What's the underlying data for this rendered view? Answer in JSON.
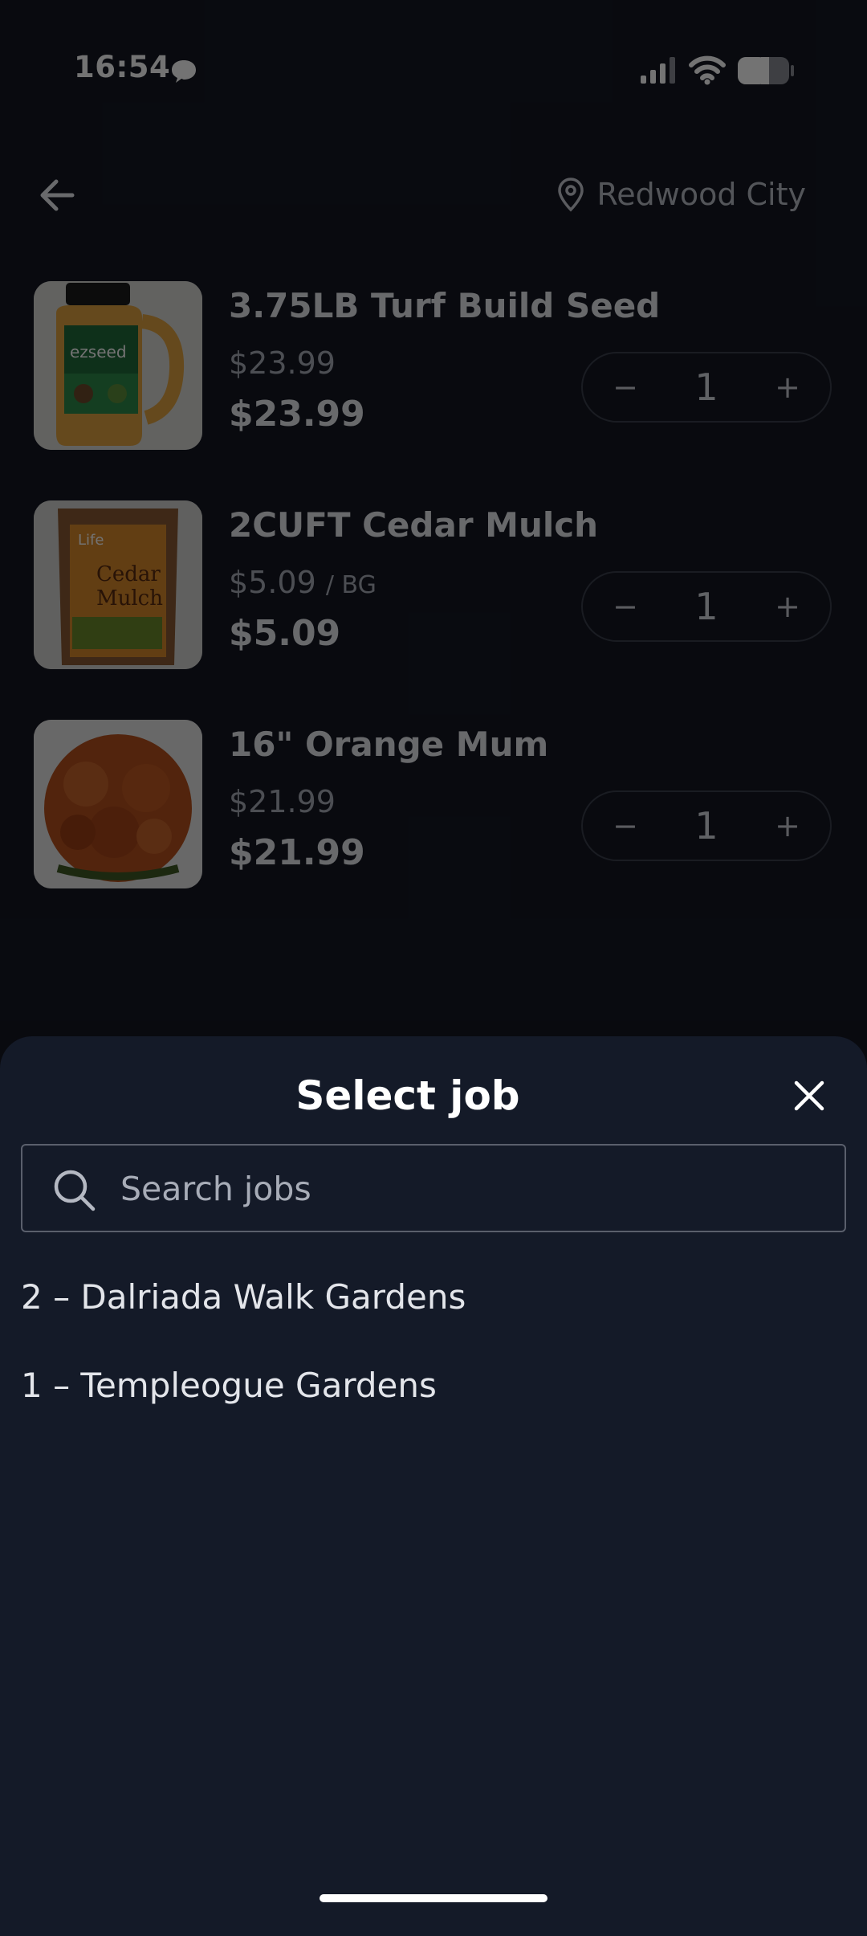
{
  "status_bar": {
    "time": "16:54"
  },
  "header": {
    "location": "Redwood City"
  },
  "products": [
    {
      "name": "3.75LB Turf Build Seed",
      "unit_price": "$23.99",
      "unit": "",
      "total": "$23.99",
      "quantity": "1"
    },
    {
      "name": "2CUFT Cedar Mulch",
      "unit_price": "$5.09",
      "unit": "/ BG",
      "total": "$5.09",
      "quantity": "1"
    },
    {
      "name": "16\" Orange Mum",
      "unit_price": "$21.99",
      "unit": "",
      "total": "$21.99",
      "quantity": "1"
    }
  ],
  "stepper": {
    "minus": "−",
    "plus": "+"
  },
  "sheet": {
    "title": "Select job",
    "search_placeholder": "Search jobs",
    "jobs": [
      {
        "label": "2 – Dalriada Walk Gardens"
      },
      {
        "label": "1 – Templeogue Gardens"
      }
    ]
  },
  "colors": {
    "background": "#141823",
    "sheet": "#141a28",
    "accent": "#ffffff"
  },
  "icons": [
    "chat-icon",
    "signal-icon",
    "wifi-icon",
    "battery-icon",
    "back-arrow-icon",
    "location-pin-icon",
    "close-icon",
    "search-icon"
  ]
}
